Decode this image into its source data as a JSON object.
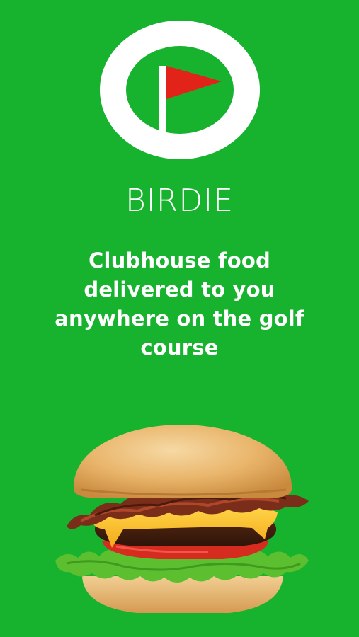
{
  "app": {
    "brand_name": "BIRDIE",
    "tagline": "Clubhouse food delivered to you anywhere on the golf course"
  },
  "logo": {
    "icon": "golf-flag-icon",
    "ring_color": "#ffffff",
    "flag_color": "#e2231a",
    "background_color": "#17b32f"
  },
  "hero_image": {
    "icon": "burger-image"
  }
}
